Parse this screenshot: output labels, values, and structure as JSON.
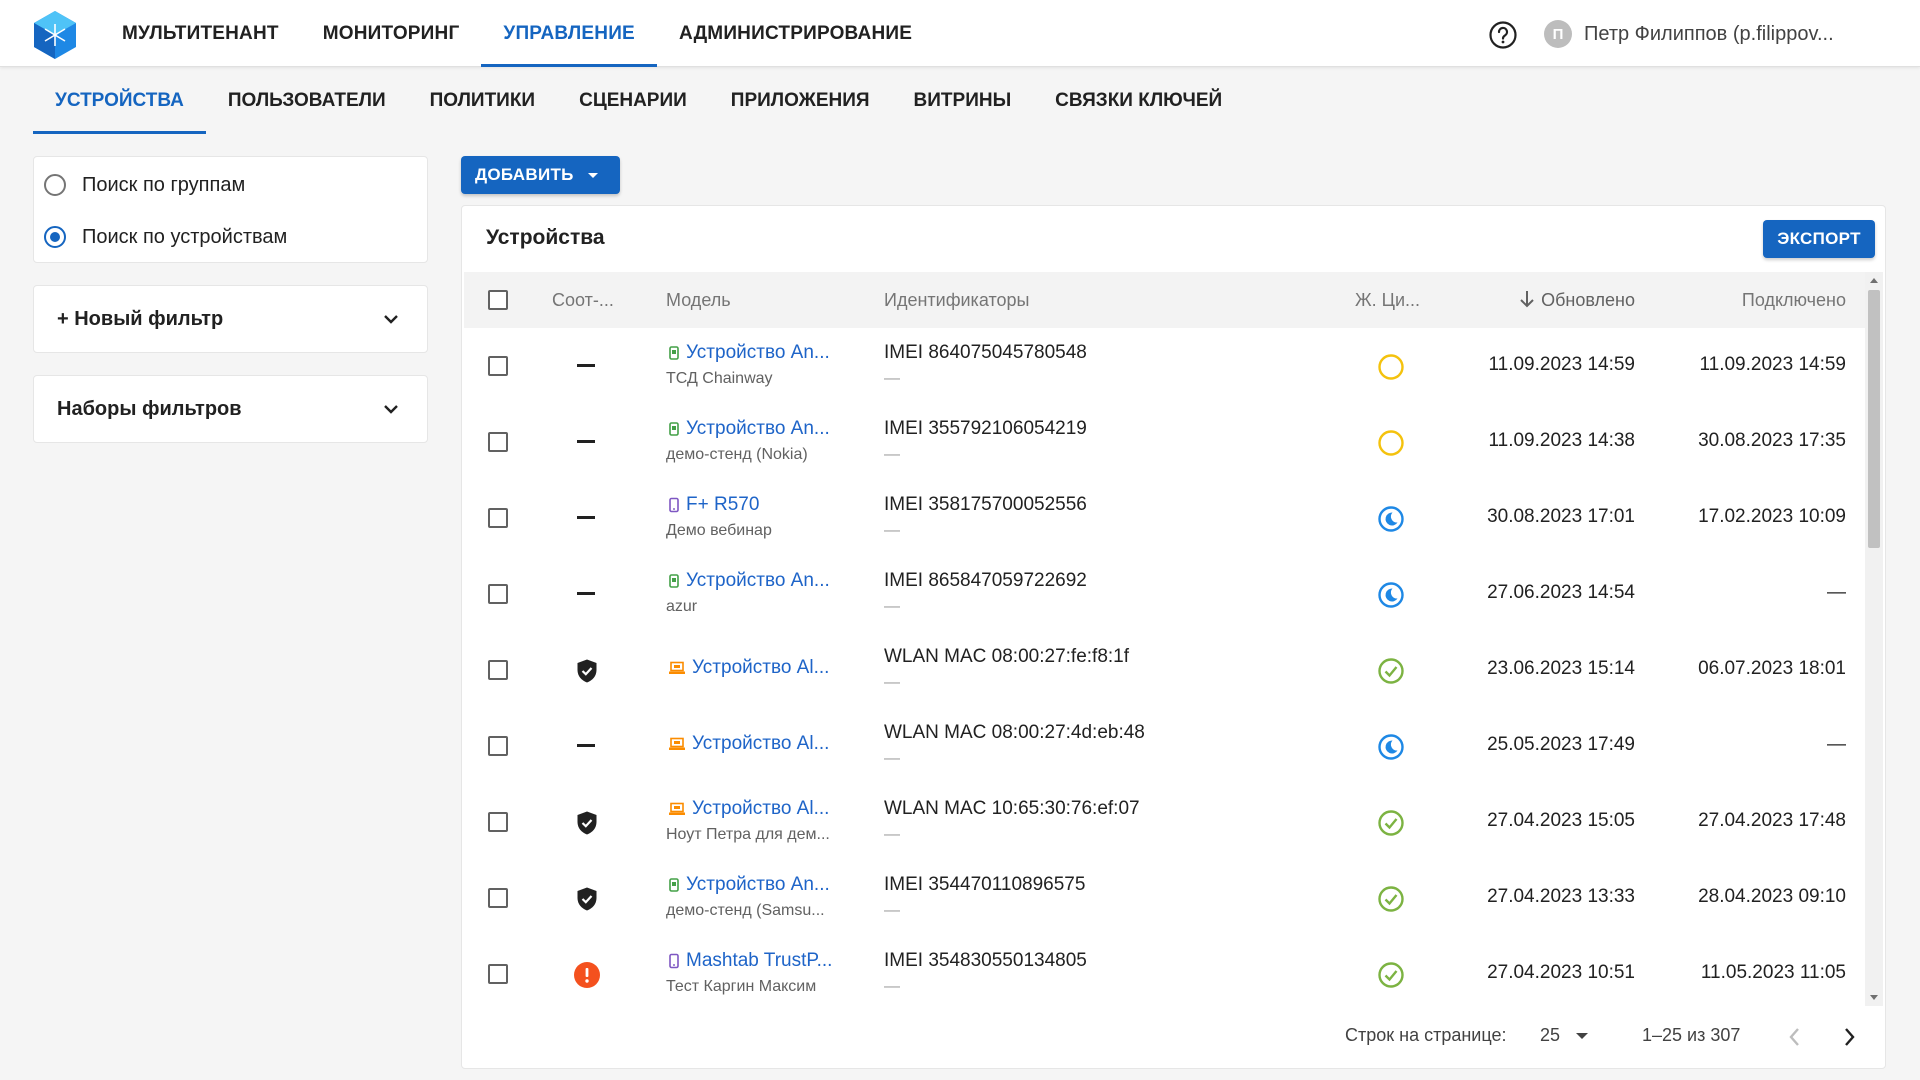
{
  "topnav": {
    "items": [
      "МУЛЬТИТЕНАНТ",
      "МОНИТОРИНГ",
      "УПРАВЛЕНИЕ",
      "АДМИНИСТРИРОВАНИЕ"
    ],
    "active_index": 2
  },
  "user": {
    "initial": "П",
    "name": "Петр Филиппов (p.filippov..."
  },
  "subnav": {
    "items": [
      "УСТРОЙСТВА",
      "ПОЛЬЗОВАТЕЛИ",
      "ПОЛИТИКИ",
      "СЦЕНАРИИ",
      "ПРИЛОЖЕНИЯ",
      "ВИТРИНЫ",
      "СВЯЗКИ КЛЮЧЕЙ"
    ],
    "active_index": 0
  },
  "search_mode": {
    "options": [
      "Поиск по группам",
      "Поиск по устройствам"
    ],
    "selected_index": 1
  },
  "filters": {
    "new_filter": "+ Новый фильтр",
    "filter_sets": "Наборы фильтров"
  },
  "toolbar": {
    "add_label": "ДОБАВИТЬ"
  },
  "devices": {
    "title": "Устройства",
    "export_label": "ЭКСПОРТ",
    "columns": {
      "status": "Соот-...",
      "model": "Модель",
      "identifiers": "Идентификаторы",
      "lifecycle": "Ж. Ци...",
      "updated": "Обновлено",
      "connected": "Подключено"
    },
    "rows": [
      {
        "status": "none",
        "device_icon": "android-icon",
        "model": "Устройство An...",
        "model_sub": "ТСД Chainway",
        "ident": "IMEI 864075045780548",
        "ident_sub": "—",
        "lifecycle": "pending",
        "updated": "11.09.2023 14:59",
        "connected": "11.09.2023 14:59"
      },
      {
        "status": "none",
        "device_icon": "android-icon",
        "model": "Устройство An...",
        "model_sub": "демо-стенд (Nokia)",
        "ident": "IMEI 355792106054219",
        "ident_sub": "—",
        "lifecycle": "pending",
        "updated": "11.09.2023 14:38",
        "connected": "30.08.2023 17:35"
      },
      {
        "status": "none",
        "device_icon": "phone-icon",
        "model": "F+ R570",
        "model_sub": "Демо вебинар",
        "ident": "IMEI 358175700052556",
        "ident_sub": "—",
        "lifecycle": "sleep",
        "updated": "30.08.2023 17:01",
        "connected": "17.02.2023 10:09"
      },
      {
        "status": "none",
        "device_icon": "android-icon",
        "model": "Устройство An...",
        "model_sub": "azur",
        "ident": "IMEI 865847059722692",
        "ident_sub": "—",
        "lifecycle": "sleep",
        "updated": "27.06.2023 14:54",
        "connected": "—"
      },
      {
        "status": "shield",
        "device_icon": "laptop-icon",
        "model": "Устройство Al...",
        "model_sub": "",
        "ident": "WLAN MAC 08:00:27:fe:f8:1f",
        "ident_sub": "—",
        "lifecycle": "ok",
        "updated": "23.06.2023 15:14",
        "connected": "06.07.2023 18:01"
      },
      {
        "status": "none",
        "device_icon": "laptop-icon",
        "model": "Устройство Al...",
        "model_sub": "",
        "ident": "WLAN MAC 08:00:27:4d:eb:48",
        "ident_sub": "—",
        "lifecycle": "sleep",
        "updated": "25.05.2023 17:49",
        "connected": "—"
      },
      {
        "status": "shield",
        "device_icon": "laptop-icon",
        "model": "Устройство Al...",
        "model_sub": "Ноут Петра для дем...",
        "ident": "WLAN MAC 10:65:30:76:ef:07",
        "ident_sub": "—",
        "lifecycle": "ok",
        "updated": "27.04.2023 15:05",
        "connected": "27.04.2023 17:48"
      },
      {
        "status": "shield",
        "device_icon": "android-icon",
        "model": "Устройство An...",
        "model_sub": "демо-стенд (Samsu...",
        "ident": "IMEI 354470110896575",
        "ident_sub": "—",
        "lifecycle": "ok",
        "updated": "27.04.2023 13:33",
        "connected": "28.04.2023 09:10"
      },
      {
        "status": "alert",
        "device_icon": "phone-icon",
        "model": "Mashtab TrustP...",
        "model_sub": "Тест Каргин Максим",
        "ident": "IMEI 354830550134805",
        "ident_sub": "—",
        "lifecycle": "ok",
        "updated": "27.04.2023 10:51",
        "connected": "11.05.2023 11:05"
      }
    ],
    "pagination": {
      "rows_per_page_label": "Строк на странице:",
      "rows_per_page": "25",
      "range": "1–25 из 307"
    }
  },
  "colors": {
    "accent": "#1565c0",
    "link": "#1e64c8",
    "pending": "#f4c20d",
    "sleep": "#1e88e5",
    "ok": "#7cb342",
    "alert": "#f4511e",
    "android": "#43a047",
    "phone": "#7e57c2",
    "laptop": "#fb8c00"
  }
}
